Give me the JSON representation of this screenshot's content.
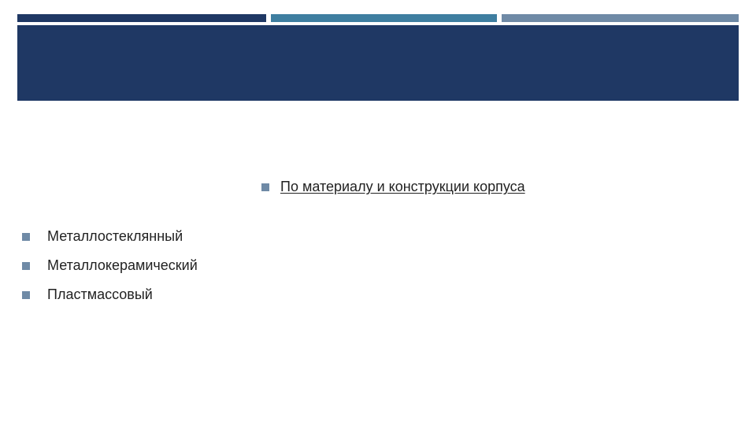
{
  "heading": "По материалу и конструкции корпуса",
  "items": [
    "Металлостеклянный",
    "Металлокерамический",
    "Пластмассовый"
  ],
  "colors": {
    "bar1": "#1f3864",
    "bar2": "#3e7ea0",
    "bar3": "#6f8aa6",
    "band": "#1f3864",
    "bullet": "#6f8aa6"
  }
}
